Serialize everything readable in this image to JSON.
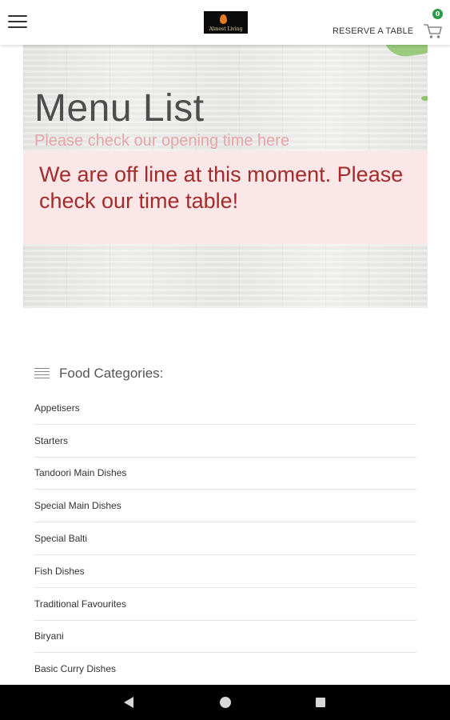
{
  "header": {
    "logo_text": "Almost Living",
    "reserve_label": "RESERVE A TABLE",
    "cart_count": "0",
    "cart_badge_color": "#2e9b4a",
    "menu_icon": "hamburger-icon",
    "cart_icon": "cart-icon"
  },
  "hero": {
    "title": "Menu List",
    "subtitle": "Please check our opening time here",
    "offline_message": "We are off line at this moment. Please check our time table!",
    "offline_bg": "#fbe7e7",
    "offline_text_color": "#a42b2b"
  },
  "categories": {
    "title": "Food Categories:",
    "icon": "list-icon",
    "items": [
      {
        "label": "Appetisers"
      },
      {
        "label": "Starters"
      },
      {
        "label": "Tandoori Main Dishes"
      },
      {
        "label": "Special Main Dishes"
      },
      {
        "label": "Special Balti"
      },
      {
        "label": "Fish Dishes"
      },
      {
        "label": "Traditional Favourites"
      },
      {
        "label": "Biryani"
      },
      {
        "label": "Basic Curry Dishes"
      }
    ]
  },
  "navbar": {
    "back_icon": "back-triangle-icon",
    "home_icon": "home-circle-icon",
    "recent_icon": "recent-apps-square-icon"
  }
}
